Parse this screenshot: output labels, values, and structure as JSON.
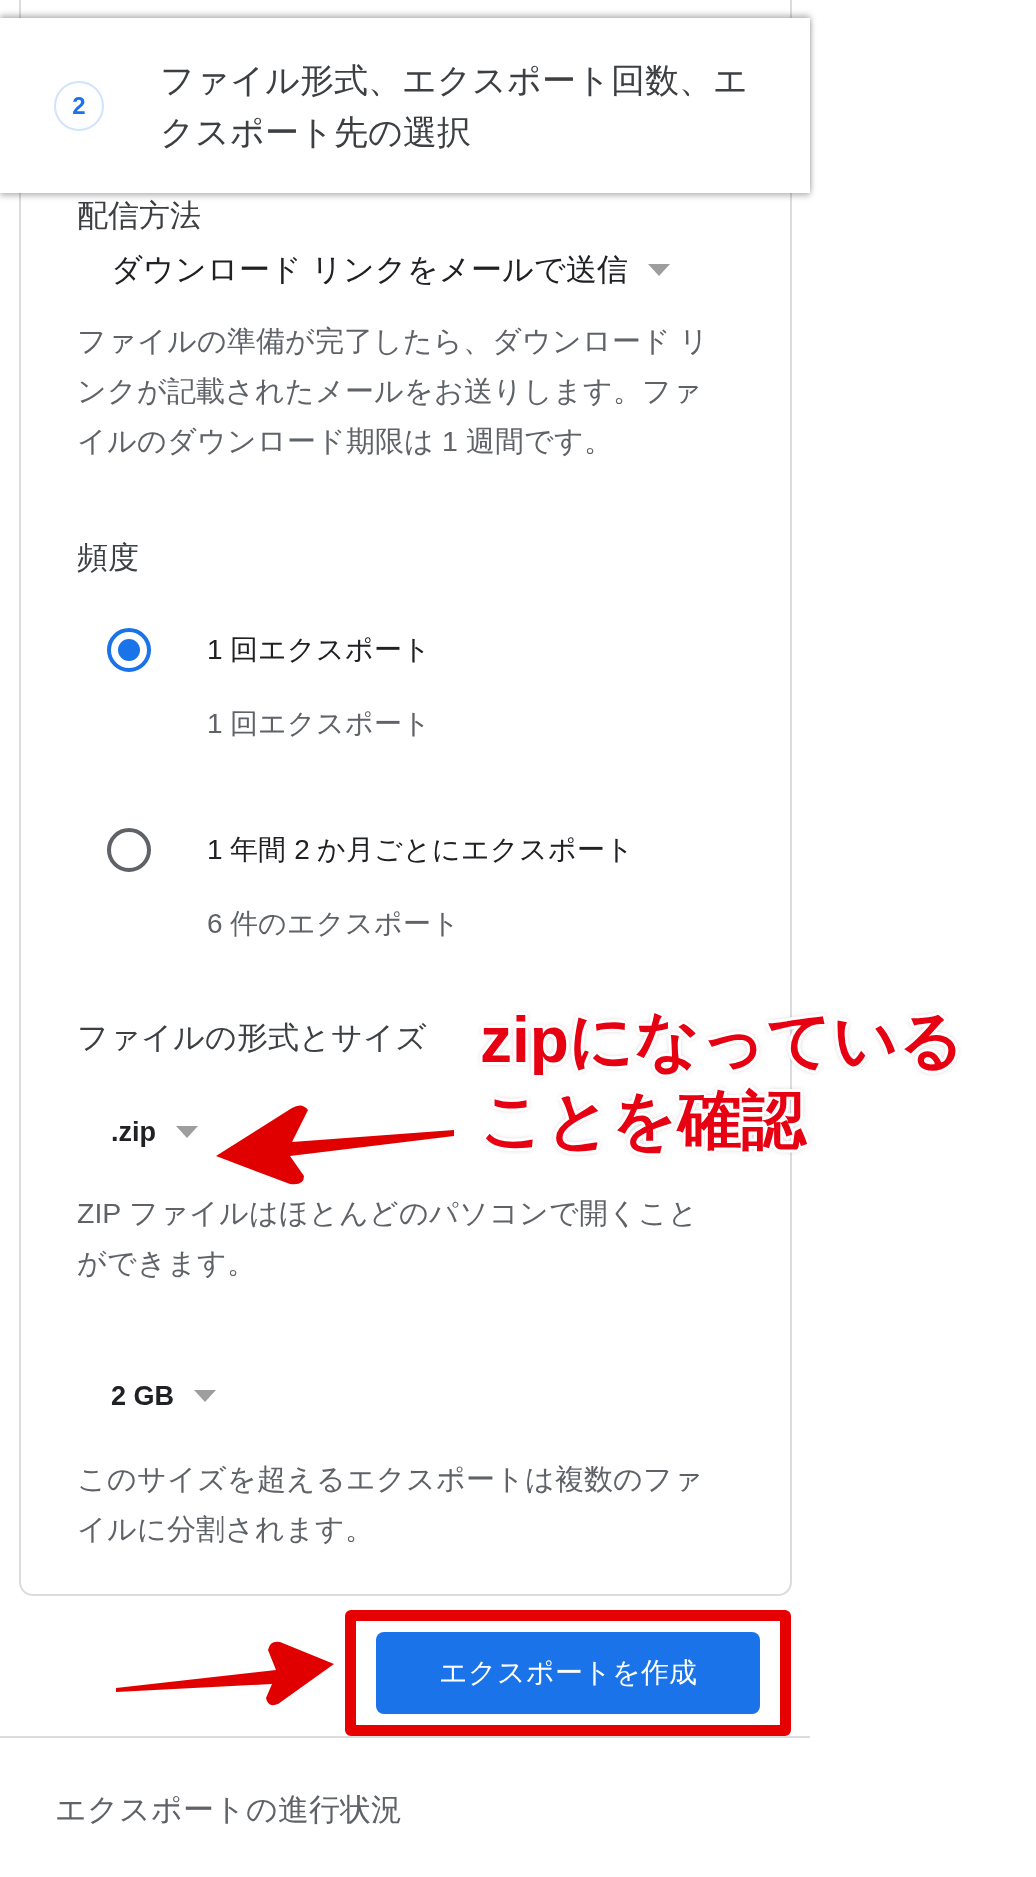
{
  "header": {
    "step": "2",
    "title": "ファイル形式、エクスポート回数、エクスポート先の選択"
  },
  "delivery": {
    "label": "配信方法",
    "dropdown": "ダウンロード リンクをメールで送信",
    "description": "ファイルの準備が完了したら、ダウンロード リンクが記載されたメールをお送りします。ファイルのダウンロード期限は 1 週間です。"
  },
  "frequency": {
    "label": "頻度",
    "options": [
      {
        "label": "1 回エクスポート",
        "detail": "1 回エクスポート",
        "selected": true
      },
      {
        "label": "1 年間 2 か月ごとにエクスポート",
        "detail": "6 件のエクスポート",
        "selected": false
      }
    ]
  },
  "format": {
    "label": "ファイルの形式とサイズ",
    "type_dropdown": ".zip",
    "type_description": "ZIP ファイルはほとんどのパソコンで開くことができます。",
    "size_dropdown": "2 GB",
    "size_description": "このサイズを超えるエクスポートは複数のファイルに分割されます。"
  },
  "create_button": {
    "label": "エクスポートを作成",
    "highlighted": true
  },
  "progress_section": "エクスポートの進行状況",
  "callout": {
    "lines": [
      "zipになっている",
      "ことを確認"
    ]
  }
}
